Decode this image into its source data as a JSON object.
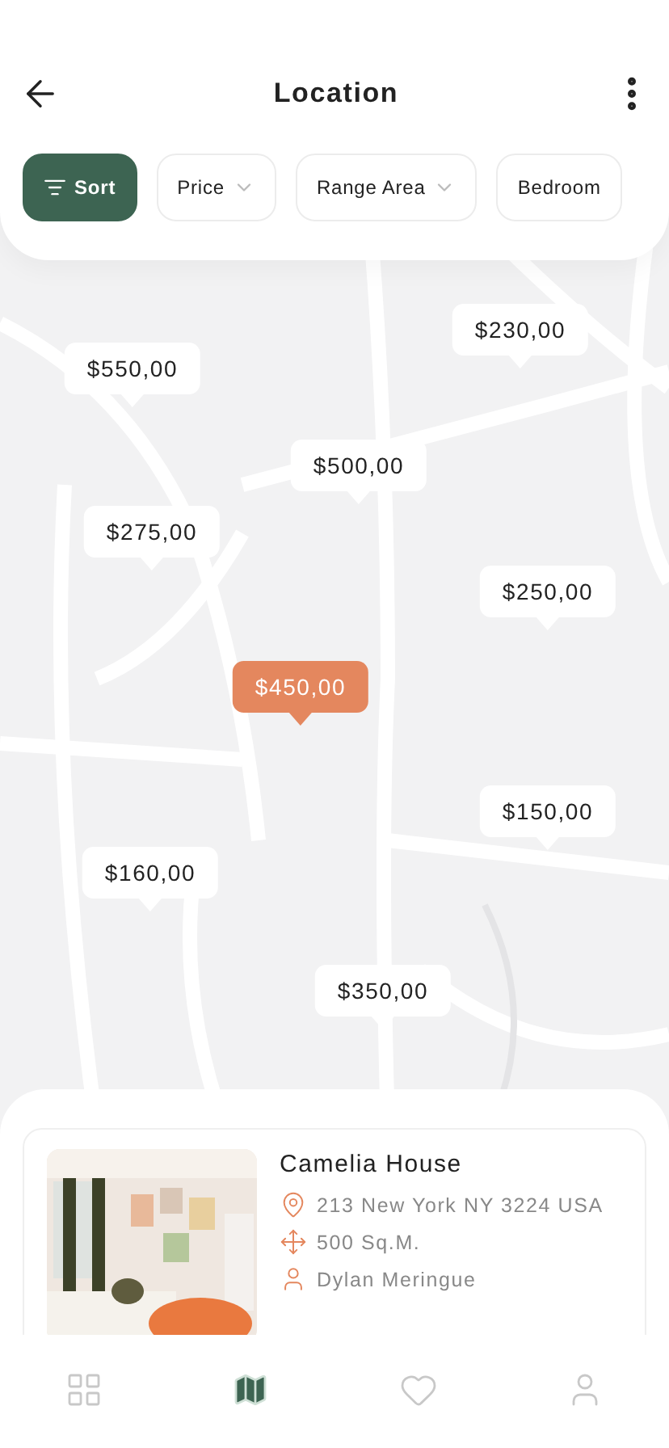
{
  "header": {
    "title": "Location"
  },
  "filters": [
    {
      "label": "Sort",
      "kind": "sort",
      "selected": true
    },
    {
      "label": "Price",
      "kind": "dropdown",
      "selected": false
    },
    {
      "label": "Range Area",
      "kind": "dropdown",
      "selected": false
    },
    {
      "label": "Bedroom",
      "kind": "plain",
      "selected": false
    }
  ],
  "pins": [
    {
      "price": "$230,00",
      "selected": false
    },
    {
      "price": "$550,00",
      "selected": false
    },
    {
      "price": "$500,00",
      "selected": false
    },
    {
      "price": "$275,00",
      "selected": false
    },
    {
      "price": "$250,00",
      "selected": false
    },
    {
      "price": "$450,00",
      "selected": true
    },
    {
      "price": "$150,00",
      "selected": false
    },
    {
      "price": "$160,00",
      "selected": false
    },
    {
      "price": "$350,00",
      "selected": false
    }
  ],
  "listing": {
    "title": "Camelia House",
    "details": [
      {
        "kind": "location",
        "text": "213 New York NY 3224 USA"
      },
      {
        "kind": "area",
        "text": "500 Sq.M."
      },
      {
        "kind": "owner",
        "text": "Dylan Meringue"
      }
    ]
  },
  "nav": [
    {
      "kind": "grid",
      "selected": false
    },
    {
      "kind": "map",
      "selected": true
    },
    {
      "kind": "heart",
      "selected": false
    },
    {
      "kind": "user",
      "selected": false
    }
  ]
}
